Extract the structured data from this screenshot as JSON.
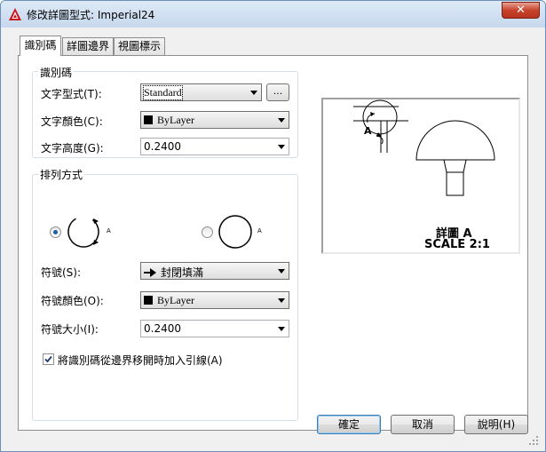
{
  "window": {
    "title": "修改詳圖型式: Imperial24",
    "close_symbol": "✕"
  },
  "tabs": [
    {
      "label": "識別碼"
    },
    {
      "label": "詳圖邊界"
    },
    {
      "label": "視圖標示"
    }
  ],
  "identifier_group": {
    "title": "識別碼",
    "text_style_label": "文字型式(T):",
    "text_style_value": "Standard",
    "browse_label": "...",
    "text_color_label": "文字顏色(C):",
    "text_color_value": "ByLayer",
    "text_height_label": "文字高度(G):",
    "text_height_value": "0.2400"
  },
  "layout_group": {
    "title": "排列方式",
    "option1_letter": "A",
    "option2_letter": "A",
    "symbol_label": "符號(S):",
    "symbol_value": "封閉填滿",
    "symbol_color_label": "符號顏色(O):",
    "symbol_color_value": "ByLayer",
    "symbol_size_label": "符號大小(I):",
    "symbol_size_value": "0.2400",
    "leader_checkbox_label": "將識別碼從邊界移開時加入引線(A)"
  },
  "preview": {
    "letter": "A",
    "caption_line1": "詳圖 A",
    "caption_line2": "SCALE 2:1"
  },
  "buttons": {
    "ok": "確定",
    "cancel": "取消",
    "help": "說明(H)"
  }
}
